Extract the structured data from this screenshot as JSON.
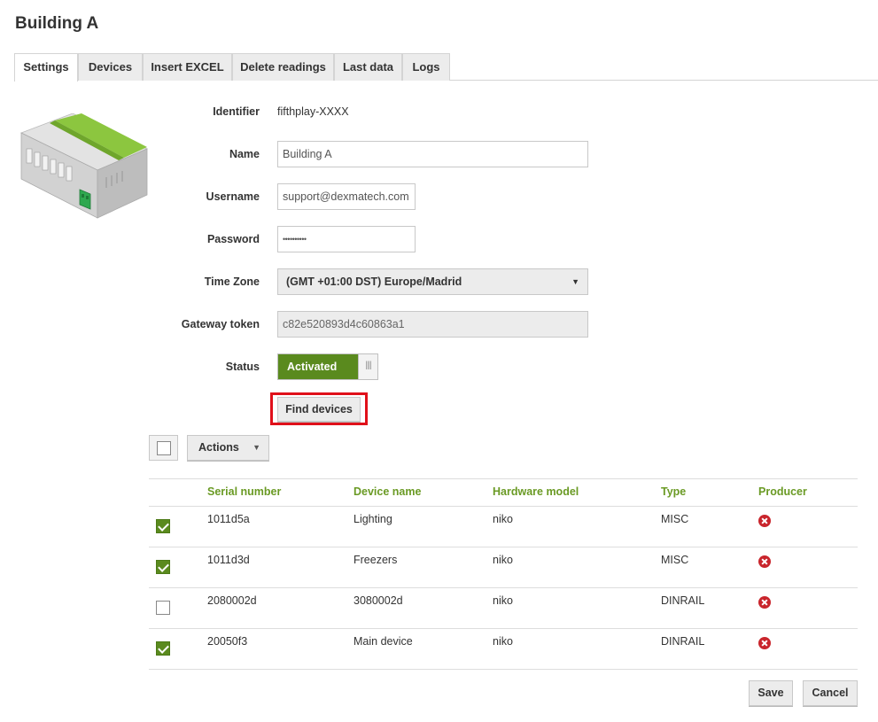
{
  "page": {
    "title": "Building A"
  },
  "tabs": [
    {
      "label": "Settings",
      "active": true
    },
    {
      "label": "Devices",
      "active": false
    },
    {
      "label": "Insert EXCEL",
      "active": false
    },
    {
      "label": "Delete readings",
      "active": false
    },
    {
      "label": "Last data",
      "active": false
    },
    {
      "label": "Logs",
      "active": false
    }
  ],
  "form": {
    "identifier_label": "Identifier",
    "identifier_value": "fifthplay-XXXX",
    "name_label": "Name",
    "name_value": "Building A",
    "username_label": "Username",
    "username_value": "support@dexmatech.com",
    "password_label": "Password",
    "password_value": "••••••••••",
    "timezone_label": "Time Zone",
    "timezone_value": "(GMT +01:00 DST) Europe/Madrid",
    "token_label": "Gateway token",
    "token_value": "c82e520893d4c60863a1",
    "status_label": "Status",
    "status_value": "Activated",
    "find_devices_label": "Find devices"
  },
  "toolbar": {
    "actions_label": "Actions"
  },
  "table": {
    "headers": [
      "Serial number",
      "Device name",
      "Hardware model",
      "Type",
      "Producer"
    ],
    "rows": [
      {
        "checked": true,
        "serial": "1011d5a",
        "name": "Lighting",
        "model": "niko",
        "type": "MISC"
      },
      {
        "checked": true,
        "serial": "1011d3d",
        "name": "Freezers",
        "model": "niko",
        "type": "MISC"
      },
      {
        "checked": false,
        "serial": "2080002d",
        "name": "3080002d",
        "model": "niko",
        "type": "DINRAIL"
      },
      {
        "checked": true,
        "serial": "20050f3",
        "name": "Main device",
        "model": "niko",
        "type": "DINRAIL"
      }
    ]
  },
  "footer": {
    "save_label": "Save",
    "cancel_label": "Cancel"
  },
  "colors": {
    "accent": "#5a8a1e",
    "header_text": "#6a9a24",
    "highlight": "#e0101a",
    "remove": "#c9252c"
  }
}
